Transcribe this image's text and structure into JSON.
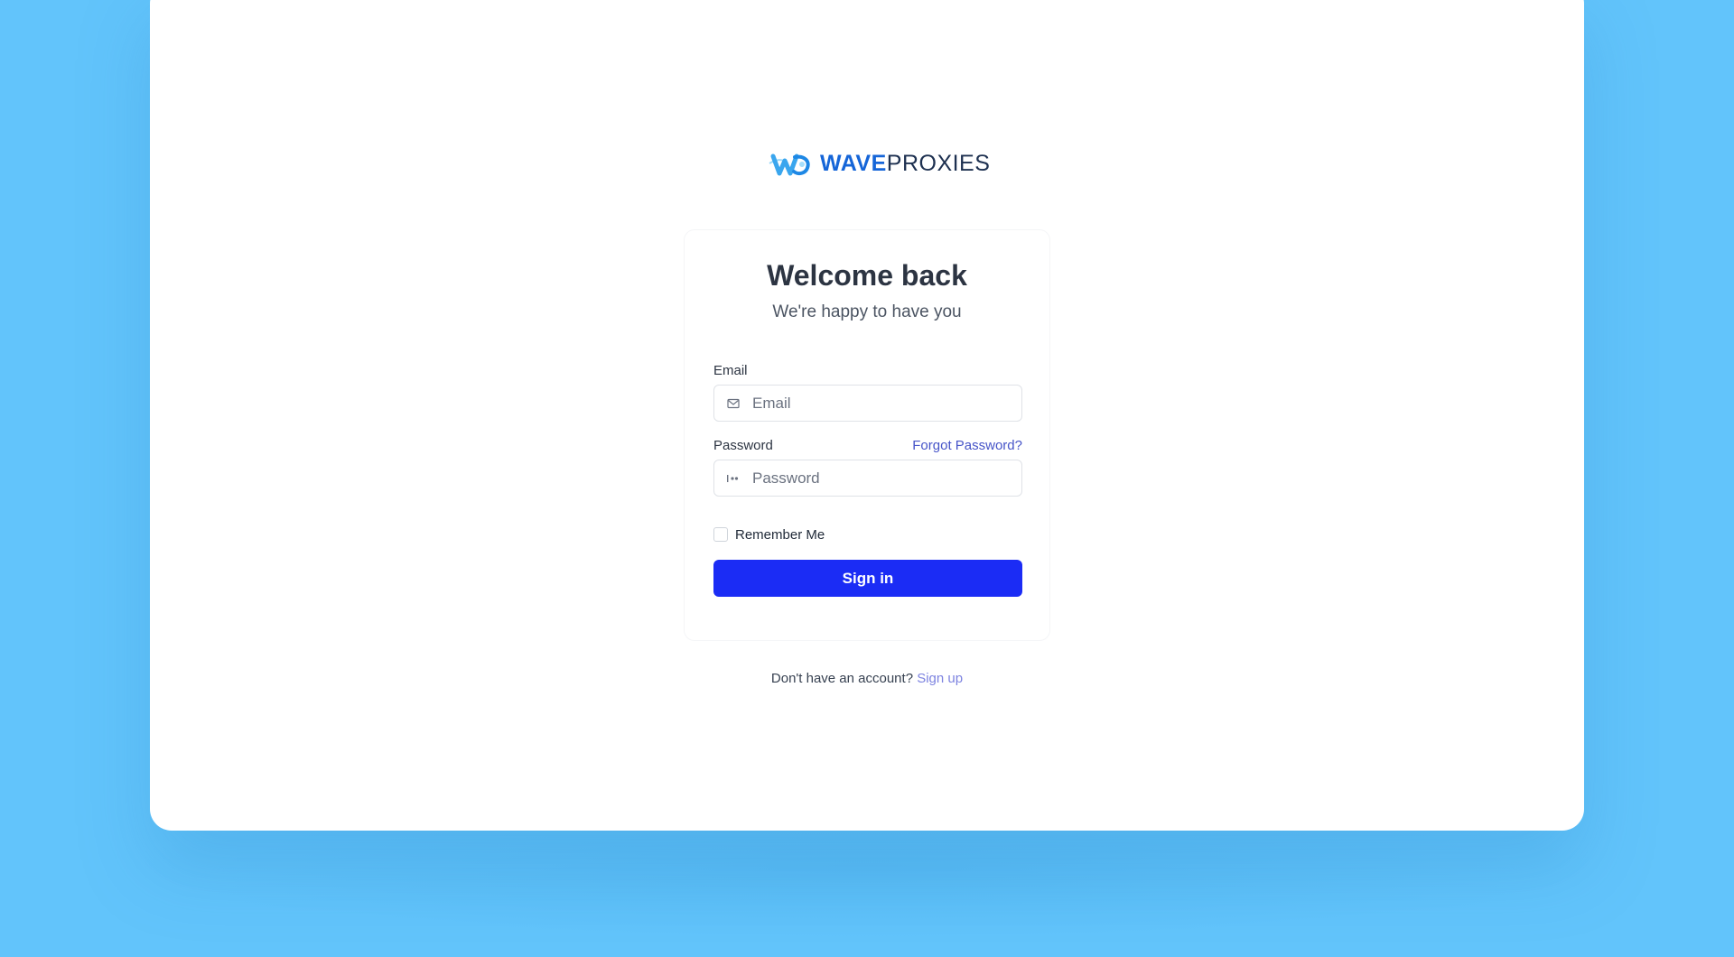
{
  "brand": {
    "name_bold": "WAVE",
    "name_light": "PROXIES",
    "primary_color": "#1565d8",
    "logo_icon": "wave-w-logo-icon"
  },
  "login": {
    "title": "Welcome back",
    "subtitle": "We're happy to have you",
    "email": {
      "label": "Email",
      "placeholder": "Email",
      "value": "",
      "icon": "mail-icon"
    },
    "password": {
      "label": "Password",
      "placeholder": "Password",
      "value": "",
      "icon": "key-icon",
      "forgot_link": "Forgot Password?"
    },
    "remember_me": {
      "label": "Remember Me",
      "checked": false
    },
    "submit_label": "Sign in",
    "submit_color": "#1b2cf5"
  },
  "footer": {
    "prompt": "Don't have an account?",
    "signup_link": "Sign up"
  }
}
